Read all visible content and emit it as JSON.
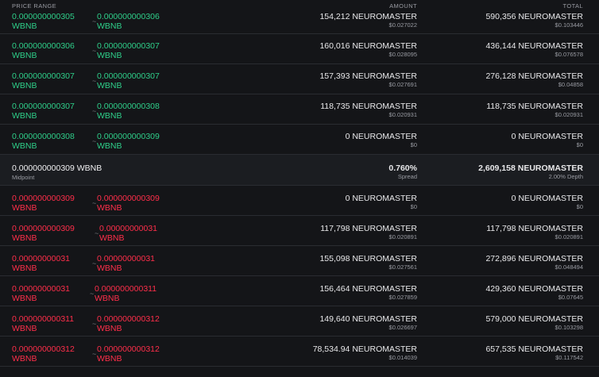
{
  "header": {
    "price": "PRICE RANGE",
    "amount": "AMOUNT",
    "total": "TOTAL"
  },
  "colors": {
    "buy": "#2ecf8a",
    "sell": "#ff2e4a"
  },
  "buy_rows": [
    {
      "p1": "0.000000000305",
      "p1b": "WBNB",
      "p2": "0.000000000306",
      "p2b": "WBNB",
      "amount": "154,212 NEUROMASTER",
      "amount_usd": "$0.027022",
      "total": "590,356 NEUROMASTER",
      "total_usd": "$0.103446"
    },
    {
      "p1": "0.000000000306",
      "p1b": "WBNB",
      "p2": "0.000000000307",
      "p2b": "WBNB",
      "amount": "160,016 NEUROMASTER",
      "amount_usd": "$0.028095",
      "total": "436,144 NEUROMASTER",
      "total_usd": "$0.076578"
    },
    {
      "p1": "0.000000000307",
      "p1b": "WBNB",
      "p2": "0.000000000307",
      "p2b": "WBNB",
      "amount": "157,393 NEUROMASTER",
      "amount_usd": "$0.027691",
      "total": "276,128 NEUROMASTER",
      "total_usd": "$0.04858"
    },
    {
      "p1": "0.000000000307",
      "p1b": "WBNB",
      "p2": "0.000000000308",
      "p2b": "WBNB",
      "amount": "118,735 NEUROMASTER",
      "amount_usd": "$0.020931",
      "total": "118,735 NEUROMASTER",
      "total_usd": "$0.020931"
    },
    {
      "p1": "0.000000000308",
      "p1b": "WBNB",
      "p2": "0.000000000309",
      "p2b": "WBNB",
      "amount": "0 NEUROMASTER",
      "amount_usd": "$0",
      "total": "0 NEUROMASTER",
      "total_usd": "$0"
    }
  ],
  "midpoint": {
    "price": "0.000000000309 WBNB",
    "label": "Midpoint",
    "spread": "0.760%",
    "spread_label": "Spread",
    "depth": "2,609,158 NEUROMASTER",
    "depth_label": "2.00% Depth"
  },
  "sell_rows": [
    {
      "p1": "0.000000000309",
      "p1b": "WBNB",
      "p2": "0.000000000309",
      "p2b": "WBNB",
      "amount": "0 NEUROMASTER",
      "amount_usd": "$0",
      "total": "0 NEUROMASTER",
      "total_usd": "$0"
    },
    {
      "p1": "0.000000000309",
      "p1b": "WBNB",
      "p2": "0.00000000031",
      "p2b": "WBNB",
      "amount": "117,798 NEUROMASTER",
      "amount_usd": "$0.020891",
      "total": "117,798 NEUROMASTER",
      "total_usd": "$0.020891"
    },
    {
      "p1": "0.00000000031",
      "p1b": "WBNB",
      "p2": "0.00000000031",
      "p2b": "WBNB",
      "amount": "155,098 NEUROMASTER",
      "amount_usd": "$0.027561",
      "total": "272,896 NEUROMASTER",
      "total_usd": "$0.048494"
    },
    {
      "p1": "0.00000000031",
      "p1b": "WBNB",
      "p2": "0.000000000311",
      "p2b": "WBNB",
      "amount": "156,464 NEUROMASTER",
      "amount_usd": "$0.027859",
      "total": "429,360 NEUROMASTER",
      "total_usd": "$0.07645"
    },
    {
      "p1": "0.000000000311",
      "p1b": "WBNB",
      "p2": "0.000000000312",
      "p2b": "WBNB",
      "amount": "149,640 NEUROMASTER",
      "amount_usd": "$0.026697",
      "total": "579,000 NEUROMASTER",
      "total_usd": "$0.103298"
    },
    {
      "p1": "0.000000000312",
      "p1b": "WBNB",
      "p2": "0.000000000312",
      "p2b": "WBNB",
      "amount": "78,534.94 NEUROMASTER",
      "amount_usd": "$0.014039",
      "total": "657,535 NEUROMASTER",
      "total_usd": "$0.117542"
    }
  ]
}
